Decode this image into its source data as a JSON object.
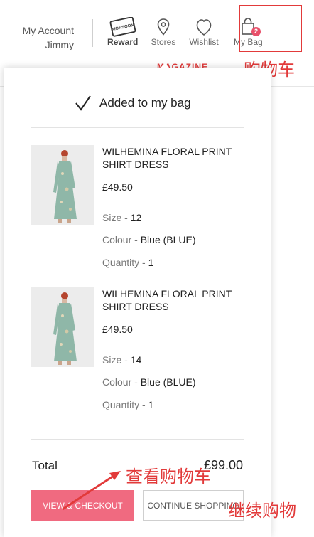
{
  "header": {
    "account_line1": "My Account",
    "account_line2": "Jimmy",
    "reward_label": "Reward",
    "reward_logo_text": "MONSOON",
    "stores_label": "Stores",
    "wishlist_label": "Wishlist",
    "bag_label": "My Bag",
    "bag_count": "2",
    "nav_magazine": "MAGAZINE"
  },
  "annotations": {
    "cart": "购物车",
    "view_cart": "查看购物车",
    "continue": "继续购物"
  },
  "bag": {
    "added_text": "Added to my bag",
    "items": [
      {
        "name": "WILHEMINA FLORAL PRINT SHIRT DRESS",
        "price": "£49.50",
        "size_label": "Size",
        "size": "12",
        "colour_label": "Colour",
        "colour": "Blue (BLUE)",
        "quantity_label": "Quantity",
        "quantity": "1"
      },
      {
        "name": "WILHEMINA FLORAL PRINT SHIRT DRESS",
        "price": "£49.50",
        "size_label": "Size",
        "size": "14",
        "colour_label": "Colour",
        "colour": "Blue (BLUE)",
        "quantity_label": "Quantity",
        "quantity": "1"
      }
    ],
    "total_label": "Total",
    "total_value": "£99.00",
    "checkout_button": "VIEW & CHECKOUT",
    "continue_button": "CONTINUE SHOPPING"
  },
  "colors": {
    "accent": "#f06a80",
    "annotation": "#e23a3a"
  }
}
